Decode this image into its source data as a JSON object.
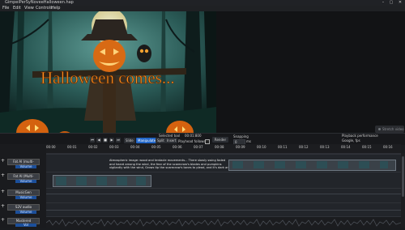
{
  "window": {
    "title": "GimpeiPerSyNoveeHalloween.hap",
    "controls": [
      "–",
      "▢",
      "✕"
    ]
  },
  "menu": [
    "File",
    "Edit",
    "View",
    "Controls",
    "Help"
  ],
  "video": {
    "overlay_text": "Halloween comes...",
    "icon_names": [
      "scarecrow",
      "pumpkin",
      "owl"
    ]
  },
  "side_buttons": {
    "stretch": "Stretch video"
  },
  "toolbar": {
    "time_track_label": "TimeTrack",
    "timeline_scale_label": "Timeline scale",
    "transport": [
      "⏮",
      "◀",
      "■",
      "▶",
      "⏭"
    ],
    "mode_buttons": [
      "Slide",
      "Manipulate",
      "Split",
      "Insert"
    ],
    "selected_tool_label": "Selected tool",
    "selected_tool_value": "00:01:800",
    "playhead_follows_label": "Playhead follows",
    "render_label": "Render",
    "snapping_label": "Snapping",
    "snapping_value": "0",
    "snapping_unit": "ms",
    "playback_perf_label": "Playback performance",
    "playback_perf_value": "Google, fps"
  },
  "ruler": {
    "ticks": [
      "00:00",
      "00:01",
      "00:02",
      "00:03",
      "00:04",
      "00:05",
      "00:06",
      "00:07",
      "00:08",
      "00:09",
      "00:10",
      "00:11",
      "00:12",
      "00:13",
      "00:14",
      "00:15",
      "00:16"
    ]
  },
  "tracks": [
    {
      "name": "Fat AI (multi-",
      "volume": "Volume"
    },
    {
      "name": "Fat AI (Multi-",
      "volume": "Volume"
    },
    {
      "name": "MusicGen",
      "volume": "Volume"
    },
    {
      "name": "S2V audio",
      "volume": "Volume"
    },
    {
      "name": "Mastered",
      "volume": "Vol"
    }
  ],
  "subtitle_text": "Atmospheric image: wood and tentacle movements... There slowly swing faded and heard among the wind, the fear of the scarecrow's blades and pumpkins vigilantly with the wind, Grows tip the scarecrow's tones to plead, and it's dark and",
  "colors": {
    "accent": "#2166c8",
    "background": "#1a1c1f"
  }
}
